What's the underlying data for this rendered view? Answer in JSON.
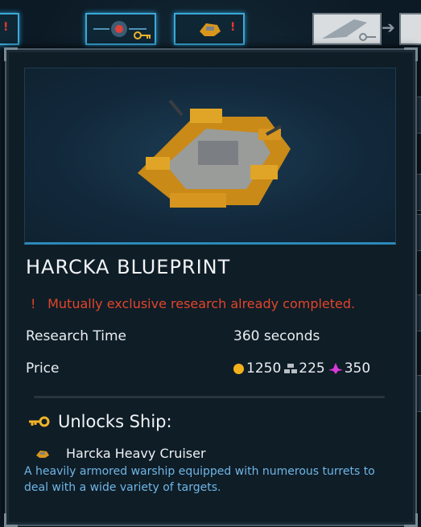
{
  "tooltip": {
    "title": "HARCKA BLUEPRINT",
    "warning_mark": "!",
    "warning": "Mutually exclusive research already completed.",
    "research_time_label": "Research Time",
    "research_time_value": "360 seconds",
    "price_label": "Price",
    "price": {
      "credits": "1250",
      "metal": "225",
      "crystal": "350"
    },
    "unlocks_heading": "Unlocks Ship:",
    "ship_name": "Harcka Heavy Cruiser",
    "ship_description": "A heavily armored warship equipped with numerous turrets to deal with a wide variety of targets."
  },
  "tree": {
    "warning_mark": "!"
  },
  "colors": {
    "warning": "#e2452a",
    "description": "#6fb6e6",
    "credits": "#f3b21c",
    "crystal": "#d93ad6",
    "highlight": "#3aa9d8"
  },
  "icons": [
    "key-icon",
    "warning-icon",
    "credits-icon",
    "metal-icon",
    "crystal-icon",
    "ship-thumbnail-icon",
    "arrow-right-icon"
  ]
}
